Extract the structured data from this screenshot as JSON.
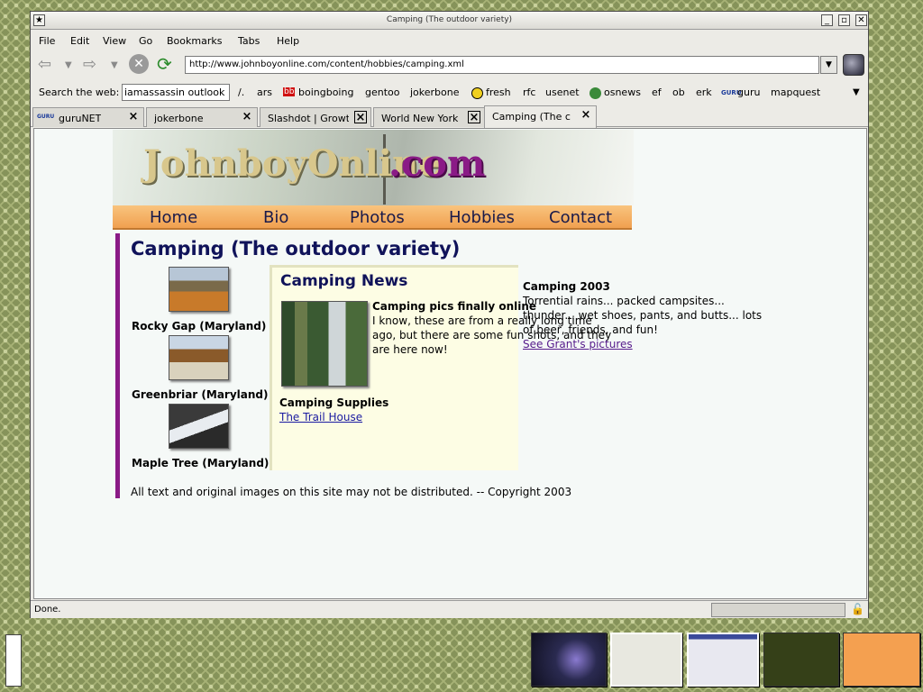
{
  "window": {
    "title": "Camping (The outdoor variety)"
  },
  "menu": [
    "File",
    "Edit",
    "View",
    "Go",
    "Bookmarks",
    "Tabs",
    "Help"
  ],
  "url": "http://www.johnboyonline.com/content/hobbies/camping.xml",
  "search": {
    "label": "Search the web:",
    "value": "iamassassin outlook"
  },
  "bookmarks": [
    "/.",
    "ars",
    "boingboing",
    "gentoo",
    "jokerbone",
    "fresh",
    "rfc",
    "usenet",
    "osnews",
    "ef",
    "ob",
    "erk",
    "guru",
    "mapquest"
  ],
  "tabs": [
    "guruNET",
    "jokerbone",
    "Slashdot | Growt",
    "World New York",
    "Camping (The c"
  ],
  "site": {
    "logo_main": "JohnboyOnline",
    "logo_tld": ".com",
    "nav": [
      "Home",
      "Bio",
      "Photos",
      "Hobbies",
      "Contact"
    ],
    "page_title": "Camping (The outdoor variety)",
    "places": [
      {
        "name": "Rocky Gap (Maryland)"
      },
      {
        "name": "Greenbriar (Maryland)"
      },
      {
        "name": "Maple Tree (Maryland)"
      }
    ],
    "news": {
      "heading": "Camping News",
      "item_title": "Camping pics finally online",
      "item_text": [
        "I know, these are from a really long time",
        "ago, but there are some fun shots, and they",
        "are here now!"
      ],
      "supplies_title": "Camping Supplies",
      "supplies_link": "The Trail House"
    },
    "side": {
      "title": "Camping 2003",
      "lines": [
        "Torrential rains... packed campsites...",
        "thunder... wet shoes, pants, and butts... lots",
        "of beer, friends, and fun!"
      ],
      "link": "See Grant's pictures"
    },
    "footer": "All text and original images on this site may not be distributed. -- Copyright 2003"
  },
  "status": "Done."
}
